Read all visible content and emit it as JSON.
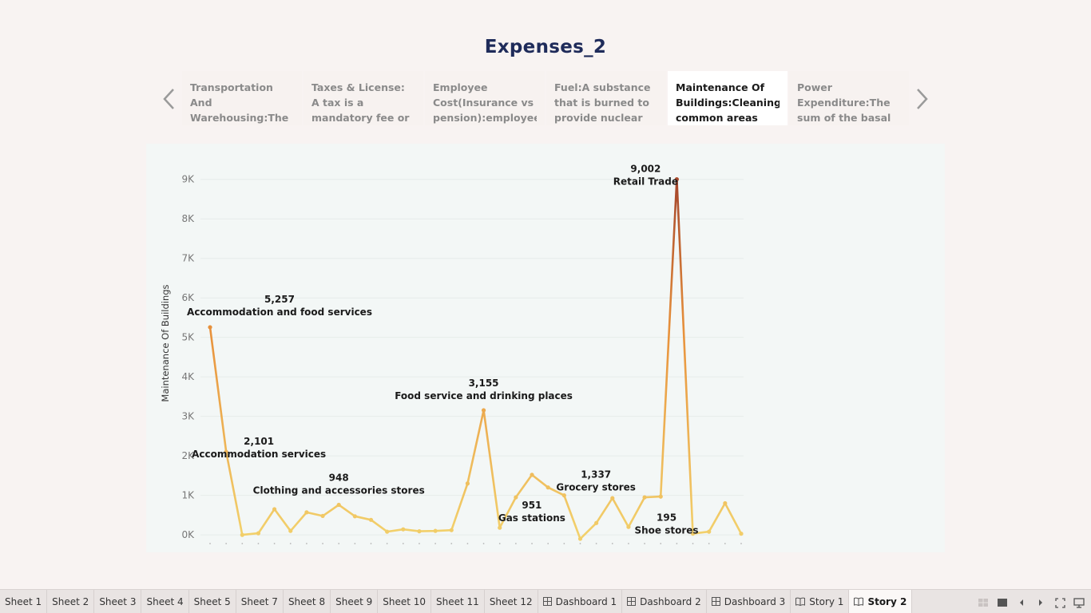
{
  "story": {
    "title": "Expenses_2",
    "points": [
      {
        "text": "Transportation And Warehousing:The transportation and warehousing",
        "active": false
      },
      {
        "text": "Taxes & License: A tax is a mandatory fee or financial charge",
        "active": false
      },
      {
        "text": "Employee Cost(Insurance vs pension):employee costs",
        "active": false
      },
      {
        "text": "Fuel:A substance that is burned to provide nuclear energy",
        "active": false
      },
      {
        "text": "Maintenance Of Buildings:Cleaning common areas",
        "active": true
      },
      {
        "text": "Power Expenditure:The sum of the basal metabolic",
        "active": false
      }
    ]
  },
  "chart_data": {
    "type": "line",
    "ylabel": "Maintenance Of Buildings",
    "xlabel": "",
    "ylim": [
      -200,
      9500
    ],
    "y_ticks": [
      {
        "v": 0,
        "label": "0K"
      },
      {
        "v": 1000,
        "label": "1K"
      },
      {
        "v": 2000,
        "label": "2K"
      },
      {
        "v": 3000,
        "label": "3K"
      },
      {
        "v": 4000,
        "label": "4K"
      },
      {
        "v": 5000,
        "label": "5K"
      },
      {
        "v": 6000,
        "label": "6K"
      },
      {
        "v": 7000,
        "label": "7K"
      },
      {
        "v": 8000,
        "label": "8K"
      },
      {
        "v": 9000,
        "label": "9K"
      }
    ],
    "color_low": "#f2d06b",
    "color_mid": "#e8923c",
    "color_high": "#a0402a",
    "values": [
      5257,
      2101,
      0,
      40,
      650,
      100,
      570,
      480,
      760,
      470,
      380,
      80,
      140,
      90,
      100,
      120,
      1300,
      3155,
      180,
      951,
      1520,
      1200,
      1000,
      -100,
      300,
      930,
      200,
      950,
      970,
      9002,
      30,
      80,
      800,
      30
    ],
    "annotations": [
      {
        "index": 0,
        "value": "5,257",
        "label": "Accommodation and food services"
      },
      {
        "index": 1,
        "value": "2,101",
        "label": "Accommodation services"
      },
      {
        "index": 8,
        "value": "948",
        "label": "Clothing and accessories stores"
      },
      {
        "index": 17,
        "value": "3,155",
        "label": "Food service and drinking places"
      },
      {
        "index": 19,
        "value": "951",
        "label": "Gas stations"
      },
      {
        "index": 21,
        "value": "1,337",
        "label": "Grocery stores"
      },
      {
        "index": 29,
        "value": "9,002",
        "label": "Retail Trade"
      },
      {
        "index": 30,
        "value": "195",
        "label": "Shoe stores"
      }
    ]
  },
  "tabs": [
    {
      "label": "Sheet 1",
      "icon": "",
      "active": false
    },
    {
      "label": "Sheet 2",
      "icon": "",
      "active": false
    },
    {
      "label": "Sheet 3",
      "icon": "",
      "active": false
    },
    {
      "label": "Sheet 4",
      "icon": "",
      "active": false
    },
    {
      "label": "Sheet 5",
      "icon": "",
      "active": false
    },
    {
      "label": "Sheet 7",
      "icon": "",
      "active": false
    },
    {
      "label": "Sheet 8",
      "icon": "",
      "active": false
    },
    {
      "label": "Sheet 9",
      "icon": "",
      "active": false
    },
    {
      "label": "Sheet 10",
      "icon": "",
      "active": false
    },
    {
      "label": "Sheet 11",
      "icon": "",
      "active": false
    },
    {
      "label": "Sheet 12",
      "icon": "",
      "active": false
    },
    {
      "label": "Dashboard 1",
      "icon": "dashboard-icon",
      "active": false
    },
    {
      "label": "Dashboard 2",
      "icon": "dashboard-icon",
      "active": false
    },
    {
      "label": "Dashboard 3",
      "icon": "dashboard-icon",
      "active": false
    },
    {
      "label": "Story 1",
      "icon": "story-icon",
      "active": false
    },
    {
      "label": "Story 2",
      "icon": "story-icon",
      "active": true
    }
  ],
  "controls": [
    "grid-view-icon",
    "filmstrip-icon",
    "previous-icon",
    "next-icon",
    "fit-screen-icon",
    "presentation-icon"
  ]
}
